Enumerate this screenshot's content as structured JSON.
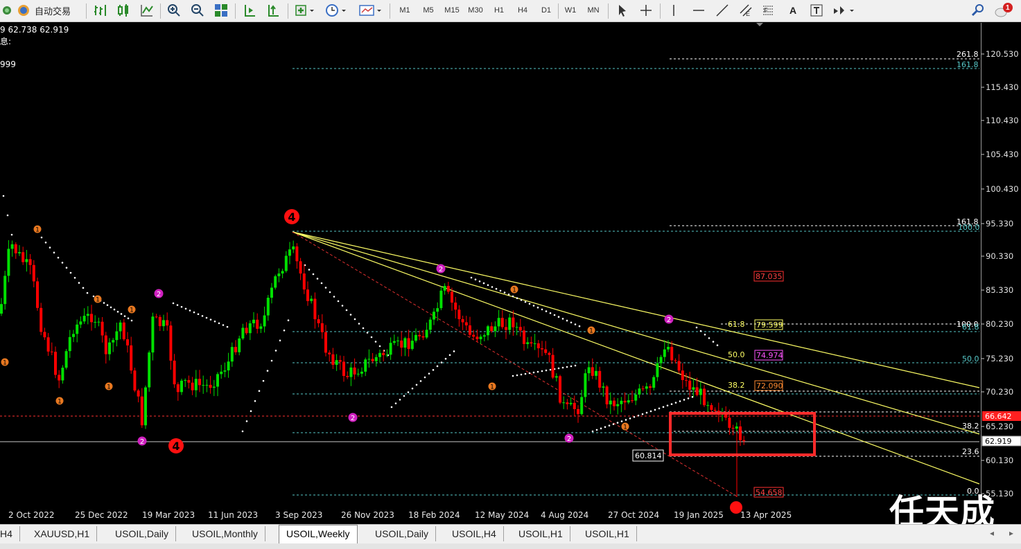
{
  "toolbar": {
    "autotrade_label": "自动交易",
    "timeframes": [
      "M1",
      "M5",
      "M15",
      "M30",
      "H1",
      "H4",
      "D1",
      "W1",
      "MN"
    ],
    "notification_count": "1"
  },
  "info": {
    "line1": "9 62.738 62.919",
    "line2": "息:",
    "line3": "999"
  },
  "price_axis": {
    "ticks": [
      "120.530",
      "115.430",
      "110.430",
      "105.430",
      "100.430",
      "95.330",
      "90.330",
      "85.330",
      "80.230",
      "75.230",
      "70.230",
      "65.230",
      "60.130",
      "55.130"
    ],
    "current_price": "62.919",
    "red_price": "66.642"
  },
  "time_axis": [
    "2 Oct 2022",
    "25 Dec 2022",
    "19 Mar 2023",
    "11 Jun 2023",
    "3 Sep 2023",
    "26 Nov 2023",
    "18 Feb 2024",
    "12 May 2024",
    "4 Aug 2024",
    "27 Oct 2024",
    "19 Jan 2025",
    "13 Apr 2025"
  ],
  "fibo_labels": {
    "upper": [
      "261.8",
      "161.8",
      "161.8",
      "100.0",
      "100.0",
      "61.8",
      "50.0",
      "38.2",
      "23.6",
      "0.0"
    ],
    "fan": [
      "61.8",
      "50.0",
      "38.2"
    ],
    "fan_boxes": [
      "79.599",
      "74.974",
      "72.090"
    ],
    "red_boxes": [
      "87.035",
      "54.658"
    ],
    "low_box": "60.814"
  },
  "wave_labels": [
    "1",
    "2",
    "4",
    "4"
  ],
  "tabs": [
    "H4",
    "XAUUSD,H1",
    "USOIL,Daily",
    "USOIL,Monthly",
    "USOIL,Weekly",
    "USOIL,Daily",
    "USOIL,H4",
    "USOIL,H1",
    "USOIL,H1"
  ],
  "active_tab": "USOIL,Weekly",
  "watermark": "任天成",
  "colors": {
    "bull": "#00e000",
    "bear": "#ff0000",
    "fibo": "#ffff66",
    "highlight": "#ff2a2a"
  },
  "chart_data": {
    "type": "candlestick",
    "symbol": "USOIL",
    "timeframe": "Weekly",
    "ylim": [
      55.13,
      120.53
    ],
    "highlight_box_prices": [
      60.814,
      66.642
    ]
  }
}
